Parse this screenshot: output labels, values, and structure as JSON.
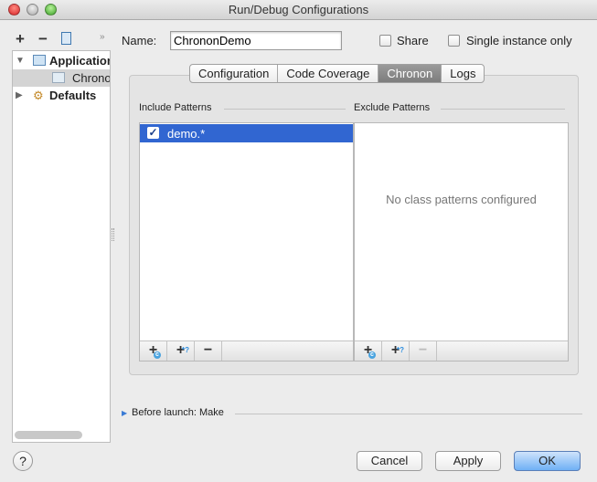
{
  "window": {
    "title": "Run/Debug Configurations"
  },
  "toolbar": {
    "add": "+",
    "remove": "−",
    "more": "»"
  },
  "tree": {
    "items": [
      {
        "label": "Application"
      },
      {
        "label": "ChrononDemo",
        "selected": true
      },
      {
        "label": "Defaults"
      }
    ]
  },
  "name_label": "Name:",
  "name_value": "ChrononDemo",
  "share_label": "Share",
  "single_instance_label": "Single instance only",
  "tabs": [
    {
      "label": "Configuration"
    },
    {
      "label": "Code Coverage"
    },
    {
      "label": "Chronon",
      "selected": true
    },
    {
      "label": "Logs"
    }
  ],
  "include": {
    "title": "Include Patterns",
    "items": [
      {
        "label": "demo.*",
        "checked": true
      }
    ]
  },
  "exclude": {
    "title": "Exclude Patterns",
    "empty": "No class patterns configured"
  },
  "before_launch": "Before launch: Make",
  "buttons": {
    "help": "?",
    "cancel": "Cancel",
    "apply": "Apply",
    "ok": "OK"
  },
  "colors": {
    "selection": "#3166d1",
    "ok": "#6fb0f5"
  }
}
